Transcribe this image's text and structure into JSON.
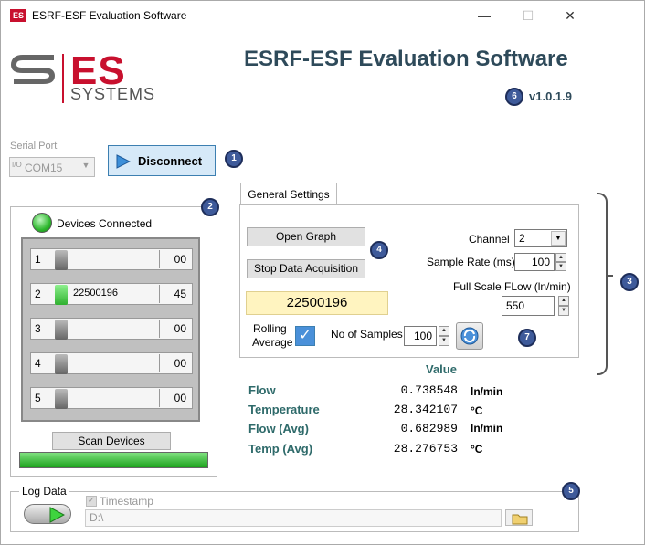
{
  "window": {
    "title": "ESRF-ESF Evaluation Software",
    "app_icon_text": "ES",
    "minimize": "—",
    "maximize": "☐",
    "close": "✕"
  },
  "logo": {
    "brand": "ES",
    "subtitle": "SYSTEMS"
  },
  "header": {
    "title": "ESRF-ESF Evaluation Software",
    "version": "v1.0.1.9"
  },
  "serial": {
    "label": "Serial Port",
    "port_value": "COM15",
    "port_icon": "I/O",
    "disconnect_label": "Disconnect"
  },
  "devices": {
    "connected_label": "Devices Connected",
    "rows": [
      {
        "num": "1",
        "id": "",
        "value": "00",
        "active": false
      },
      {
        "num": "2",
        "id": "22500196",
        "value": "45",
        "active": true
      },
      {
        "num": "3",
        "id": "",
        "value": "00",
        "active": false
      },
      {
        "num": "4",
        "id": "",
        "value": "00",
        "active": false
      },
      {
        "num": "5",
        "id": "",
        "value": "00",
        "active": false
      }
    ],
    "scan_label": "Scan Devices",
    "scan_progress": 1.0
  },
  "settings": {
    "tab_label": "General Settings",
    "open_graph_label": "Open Graph",
    "stop_acq_label": "Stop Data Acquisition",
    "serial_display": "22500196",
    "channel_label": "Channel",
    "channel_value": "2",
    "sample_rate_label": "Sample Rate (ms)",
    "sample_rate_value": "100",
    "full_scale_label": "Full Scale FLow (ln/min)",
    "full_scale_value": "550",
    "rolling_label_1": "Rolling",
    "rolling_label_2": "Average",
    "rolling_checked": true,
    "samples_label": "No of Samples",
    "samples_value": "100"
  },
  "values": {
    "header": "Value",
    "rows": [
      {
        "label": "Flow",
        "value": "0.738548",
        "unit": "ln/min"
      },
      {
        "label": "Temperature",
        "value": "28.342107",
        "unit": "°C"
      },
      {
        "label": "Flow (Avg)",
        "value": "0.682989",
        "unit": "ln/min"
      },
      {
        "label": "Temp (Avg)",
        "value": "28.276753",
        "unit": "°C"
      }
    ]
  },
  "log": {
    "title": "Log Data",
    "timestamp_label": "Timestamp",
    "timestamp_checked": true,
    "path_value": "D:\\"
  },
  "badges": {
    "b1": "1",
    "b2": "2",
    "b3": "3",
    "b4": "4",
    "b5": "5",
    "b6": "6",
    "b7": "7"
  },
  "colors": {
    "accent": "#c8102e",
    "title": "#2e4a5a",
    "badge": "#3e5a9a",
    "progress": "#1ca21c"
  }
}
